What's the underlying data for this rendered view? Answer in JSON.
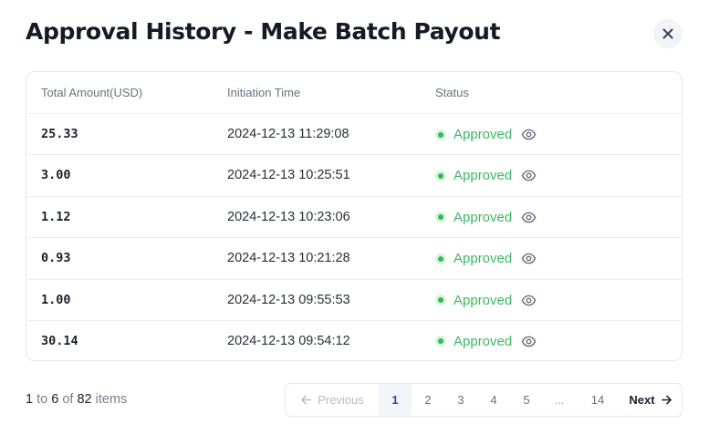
{
  "modal": {
    "title": "Approval History - Make Batch Payout",
    "close_icon": "close-icon"
  },
  "table": {
    "columns": [
      "Total Amount(USD)",
      "Initiation Time",
      "Status"
    ],
    "rows": [
      {
        "amount": "25.33",
        "time": "2024-12-13 11:29:08",
        "status": "Approved"
      },
      {
        "amount": "3.00",
        "time": "2024-12-13 10:25:51",
        "status": "Approved"
      },
      {
        "amount": "1.12",
        "time": "2024-12-13 10:23:06",
        "status": "Approved"
      },
      {
        "amount": "0.93",
        "time": "2024-12-13 10:21:28",
        "status": "Approved"
      },
      {
        "amount": "1.00",
        "time": "2024-12-13 09:55:53",
        "status": "Approved"
      },
      {
        "amount": "30.14",
        "time": "2024-12-13 09:54:12",
        "status": "Approved"
      }
    ],
    "status_icon": "status-dot-icon",
    "action_icon": "eye-icon"
  },
  "pagination": {
    "summary": {
      "from": "1",
      "to_word": "to",
      "to": "6",
      "of_word": "of",
      "total": "82",
      "unit": "items"
    },
    "previous_label": "Previous",
    "next_label": "Next",
    "pages": [
      "1",
      "2",
      "3",
      "4",
      "5"
    ],
    "ellipsis": "...",
    "last_page": "14",
    "current_page": "1"
  },
  "colors": {
    "approved": "#3cb862",
    "active_page": "#1f47c7",
    "title": "#151a24"
  }
}
